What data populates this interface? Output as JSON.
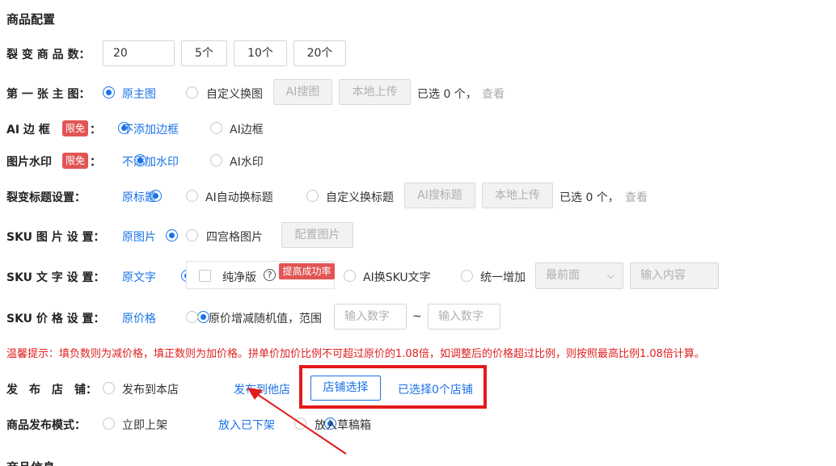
{
  "section_title": "商品配置",
  "fission_count": {
    "label": "裂 变 商 品 数：",
    "value": "20",
    "options": [
      "5个",
      "10个",
      "20个"
    ]
  },
  "main_image": {
    "label": "第 一 张 主 图：",
    "opt1": "原主图",
    "opt2": "自定义换图",
    "btn_ai": "AI搜图",
    "btn_upload": "本地上传",
    "selected": "已选 0 个，",
    "view": "查看"
  },
  "ai_border": {
    "label": "AI 边 框",
    "badge": "限免",
    "colon": "：",
    "opt1": "不添加边框",
    "opt2": "AI边框"
  },
  "watermark": {
    "label": "图片水印",
    "badge": "限免",
    "colon": "：",
    "opt1": "不添加水印",
    "opt2": "AI水印"
  },
  "title_setting": {
    "label": "裂变标题设置：",
    "opt1": "原标题",
    "opt2": "AI自动换标题",
    "opt3": "自定义换标题",
    "btn_ai": "AI搜标题",
    "btn_upload": "本地上传",
    "selected": "已选 0 个，",
    "view": "查看"
  },
  "sku_image": {
    "label": "SKU 图 片 设 置：",
    "opt1": "原图片",
    "opt2": "四宫格图片",
    "btn_config": "配置图片"
  },
  "sku_text": {
    "label": "SKU 文 字 设 置：",
    "opt1": "原文字",
    "pure": "纯净版",
    "help": "?",
    "boost": "提高成功率",
    "opt2": "AI换SKU文字",
    "opt3": "统一增加",
    "select_value": "最前面",
    "input_placeholder": "输入内容"
  },
  "sku_price": {
    "label": "SKU 价 格 设 置：",
    "opt1": "原价格",
    "opt2": "原价增减随机值，范围",
    "input1_placeholder": "输入数字",
    "tilde": "~",
    "input2_placeholder": "输入数字"
  },
  "tip": "温馨提示：填负数则为减价格，填正数则为加价格。拼单价加价比例不可超过原价的1.08倍，如调整后的价格超过比例，则按照最高比例1.08倍计算。",
  "publish_store": {
    "label": "发　布　店　铺：",
    "opt1": "发布到本店",
    "opt2": "发布到他店",
    "btn_select": "店铺选择",
    "selected": "已选择0个店铺"
  },
  "publish_mode": {
    "label": "商品发布模式：",
    "opt1": "立即上架",
    "opt2": "放入已下架",
    "opt3": "放入草稿箱"
  },
  "next_section": "商品信息",
  "colors": {
    "accent": "#1a73e8",
    "highlight": "#e21b1b",
    "badge": "#e25555"
  }
}
